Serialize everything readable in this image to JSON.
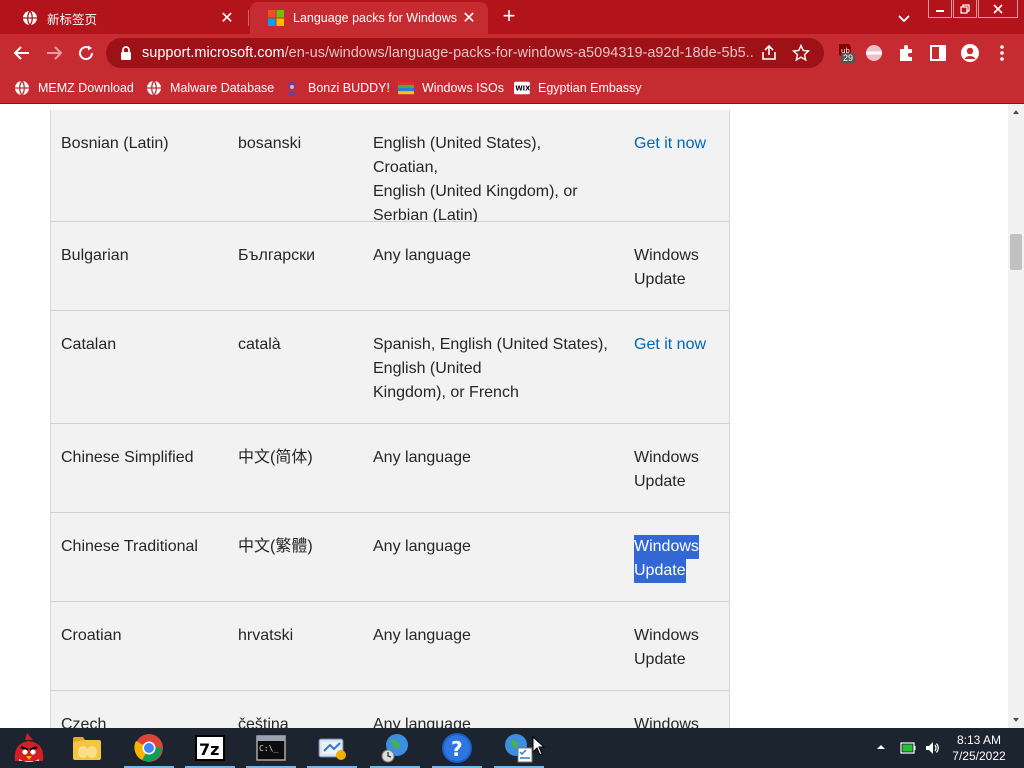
{
  "browser": {
    "tabs": [
      {
        "title": "新标签页",
        "active": false
      },
      {
        "title": "Language packs for Windows",
        "active": true
      }
    ],
    "new_tab_label": "+",
    "url_host": "support.microsoft.com",
    "url_path": "/en-us/windows/language-packs-for-windows-a5094319-a92d-18de-5b5...",
    "extension_badge": "29",
    "accent_color": "#c62b32",
    "tabstrip_color": "#b3141b"
  },
  "bookmarks": [
    {
      "label": "MEMZ Download",
      "icon": "globe-icon"
    },
    {
      "label": "Malware Database",
      "icon": "globe-icon"
    },
    {
      "label": "Bonzi BUDDY!",
      "icon": "bonzi-icon"
    },
    {
      "label": "Windows ISOs",
      "icon": "windows-flag-icon"
    },
    {
      "label": "Egyptian Embassy",
      "icon": "wix-icon"
    }
  ],
  "table": {
    "rows": [
      {
        "language": "Bosnian (Latin)",
        "native": "bosanski",
        "base_lines": [
          "English (United States), Croatian,",
          "English (United Kingdom), or",
          "Serbian (Latin)"
        ],
        "availability_lines": [
          "Get it now"
        ],
        "availability_is_link": true,
        "selected": false
      },
      {
        "language": "Bulgarian",
        "native": "Български",
        "base_lines": [
          "Any language"
        ],
        "availability_lines": [
          "Windows",
          "Update"
        ],
        "availability_is_link": false,
        "selected": false
      },
      {
        "language": "Catalan",
        "native": "català",
        "base_lines": [
          "Spanish, English (United States),",
          "English (United",
          "Kingdom), or French"
        ],
        "availability_lines": [
          "Get it now"
        ],
        "availability_is_link": true,
        "selected": false
      },
      {
        "language": "Chinese Simplified",
        "native": "中文(简体)",
        "base_lines": [
          "Any language"
        ],
        "availability_lines": [
          "Windows",
          "Update"
        ],
        "availability_is_link": false,
        "selected": false
      },
      {
        "language": "Chinese Traditional",
        "native": "中文(繁體)",
        "base_lines": [
          "Any language"
        ],
        "availability_lines": [
          "Windows",
          "Update"
        ],
        "availability_is_link": false,
        "selected": true
      },
      {
        "language": "Croatian",
        "native": "hrvatski",
        "base_lines": [
          "Any language"
        ],
        "availability_lines": [
          "Windows",
          "Update"
        ],
        "availability_is_link": false,
        "selected": false
      },
      {
        "language": "Czech",
        "native": "čeština",
        "base_lines": [
          "Any language"
        ],
        "availability_lines": [
          "Windows"
        ],
        "availability_is_link": false,
        "selected": false
      }
    ]
  },
  "taskbar": {
    "items": [
      {
        "name": "angry-birds-icon",
        "active": false
      },
      {
        "name": "file-explorer-icon",
        "active": false
      },
      {
        "name": "chrome-icon",
        "active": true
      },
      {
        "name": "7zip-icon",
        "active": true
      },
      {
        "name": "command-prompt-icon",
        "active": true
      },
      {
        "name": "control-panel-icon",
        "active": true
      },
      {
        "name": "network-globe-icon",
        "active": true
      },
      {
        "name": "help-icon",
        "active": true
      },
      {
        "name": "globe-checklist-icon",
        "active": true
      }
    ],
    "clock_time": "8:13 AM",
    "clock_date": "7/25/2022"
  },
  "selection_color": "#3367d6",
  "link_color": "#0067b8"
}
